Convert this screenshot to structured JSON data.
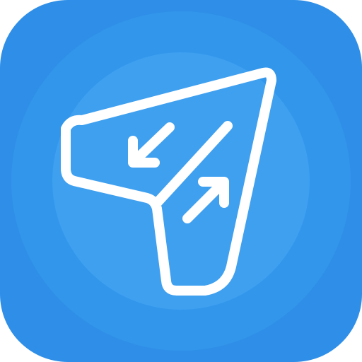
{
  "app_icon": {
    "icon_name": "paper-plane-swap-icon",
    "colors": {
      "tile_outer": "#2F8FE8",
      "ring_mid": "#3296EA",
      "disc_inner": "#3FA0F0",
      "glyph_stroke": "#FFFFFF"
    }
  }
}
